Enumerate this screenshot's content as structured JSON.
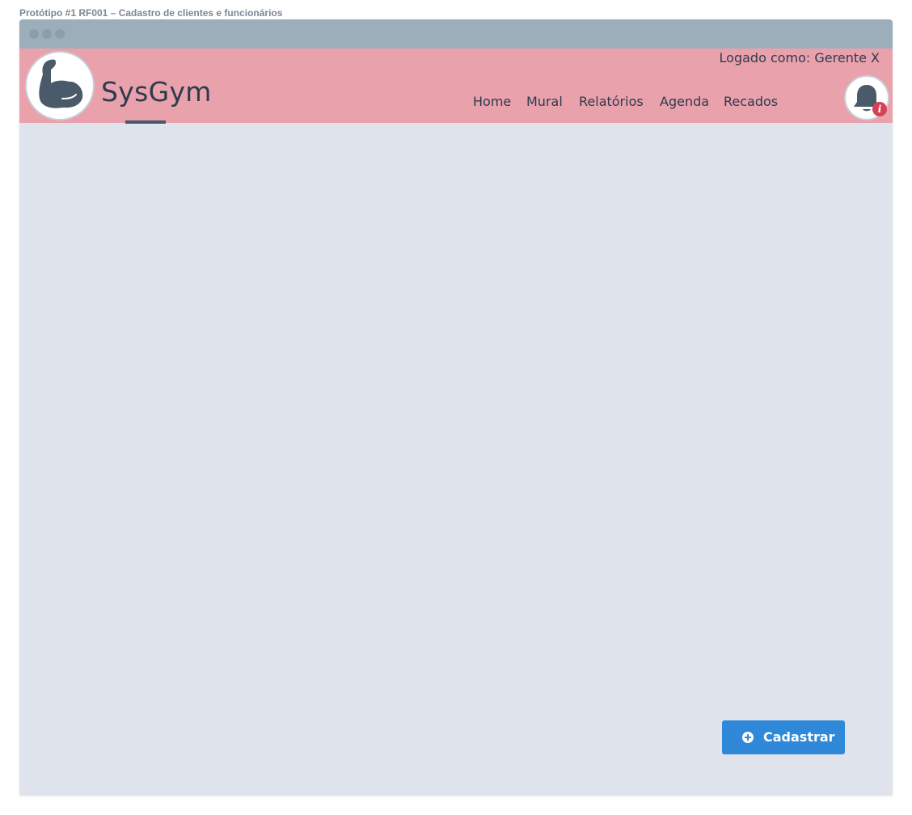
{
  "caption": "Protótipo #1 RF001 – Cadastro de clientes e funcionários",
  "header": {
    "brand": "SysGym",
    "logged_as": "Logado como: Gerente X",
    "logo_icon": "flexed-bicep-icon",
    "nav": [
      {
        "label": "Home"
      },
      {
        "label": "Mural"
      },
      {
        "label": "Relatórios"
      },
      {
        "label": "Agenda"
      },
      {
        "label": "Recados"
      }
    ],
    "notification_icon": "bell-icon",
    "notification_badge": "i"
  },
  "main": {
    "primary_action": {
      "label": "Cadastrar",
      "icon": "plus-circle-icon"
    }
  },
  "colors": {
    "titlebar": "#9daebb",
    "header": "#e9a1ac",
    "content": "#dfe4ec",
    "text": "#2e3b4e",
    "primary": "#2f88d8",
    "badge": "#d64152"
  }
}
